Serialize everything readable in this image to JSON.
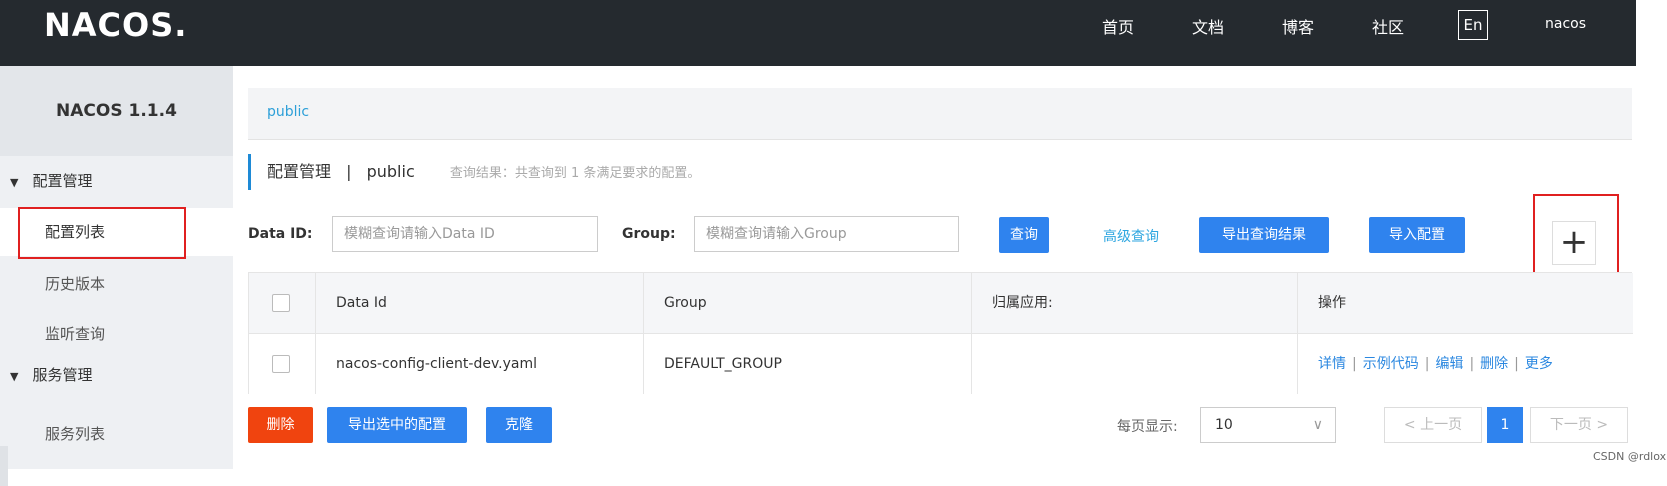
{
  "header": {
    "logo": "NACOS.",
    "nav": [
      "首页",
      "文档",
      "博客",
      "社区"
    ],
    "lang": "En",
    "user": "nacos"
  },
  "sidebar": {
    "version": "NACOS 1.1.4",
    "groups": [
      {
        "label": "配置管理",
        "items": [
          "配置列表",
          "历史版本",
          "监听查询"
        ]
      },
      {
        "label": "服务管理",
        "items": [
          "服务列表"
        ]
      }
    ],
    "active_item": "配置列表"
  },
  "main": {
    "namespace": "public",
    "title": "配置管理",
    "title_sep": "|",
    "title_ns": "public",
    "result_hint": "查询结果：共查询到 1 条满足要求的配置。",
    "search": {
      "dataid_label": "Data ID:",
      "dataid_placeholder": "模糊查询请输入Data ID",
      "group_label": "Group:",
      "group_placeholder": "模糊查询请输入Group",
      "query_btn": "查询",
      "advanced_link": "高级查询",
      "export_btn": "导出查询结果",
      "import_btn": "导入配置",
      "add_btn": "+"
    },
    "table": {
      "headers": [
        "Data Id",
        "Group",
        "归属应用:",
        "操作"
      ],
      "rows": [
        {
          "data_id": "nacos-config-client-dev.yaml",
          "group": "DEFAULT_GROUP",
          "app": "",
          "ops": [
            "详情",
            "示例代码",
            "编辑",
            "删除",
            "更多"
          ]
        }
      ]
    },
    "bottom": {
      "delete_btn": "删除",
      "export_selected_btn": "导出选中的配置",
      "clone_btn": "克隆",
      "page_size_label": "每页显示:",
      "page_size": "10",
      "prev": "< 上一页",
      "current_page": "1",
      "next": "下一页 >"
    }
  },
  "watermark": "CSDN @rdlox",
  "colors": {
    "topbar": "#252a2f",
    "primary": "#2f83ee",
    "danger": "#f0440f",
    "highlight_box": "#e02020"
  }
}
